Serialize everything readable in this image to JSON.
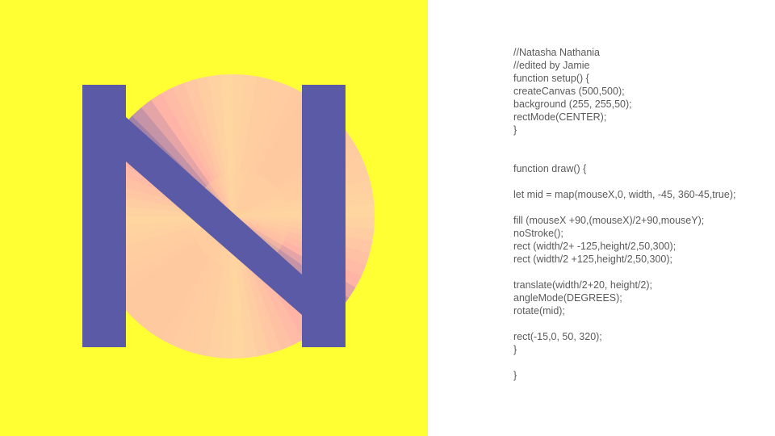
{
  "canvas": {
    "background_color": "#ffff33",
    "letter_bar_color": "#5a5aa6",
    "disc_gradient_colors": [
      "#5a5aa6",
      "#ffb3a6",
      "#ffd6a0",
      "#ffc3a0"
    ]
  },
  "code": {
    "lines": [
      "//Natasha Nathania",
      "//edited by Jamie",
      "function setup() {",
      "createCanvas (500,500);",
      "background (255, 255,50);",
      "rectMode(CENTER);",
      "}",
      "",
      "",
      "function draw() {",
      "",
      "let mid = map(mouseX,0, width, -45, 360-45,true);",
      "",
      "fill (mouseX +90,(mouseX)/2+90,mouseY);",
      "noStroke();",
      "rect (width/2+ -125,height/2,50,300);",
      "rect (width/2 +125,height/2,50,300);",
      "",
      "translate(width/2+20, height/2);",
      "angleMode(DEGREES);",
      "rotate(mid);",
      "",
      "rect(-15,0, 50, 320);",
      "}",
      "",
      "}"
    ]
  }
}
